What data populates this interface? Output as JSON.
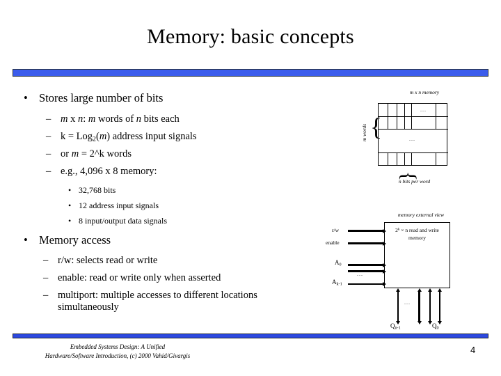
{
  "slide": {
    "title": "Memory: basic concepts",
    "page_number": "4",
    "accent_color": "#3b5cec",
    "footer_line1": "Embedded Systems Design: A Unified",
    "footer_line2": "Hardware/Software Introduction, (c) 2000 Vahid/Givargis"
  },
  "content": {
    "bullet1": "Stores large number of bits",
    "bullet1_subs": [
      {
        "pre": "",
        "italic1": "m",
        "mid": " x ",
        "italic2": "n",
        "post": ": ",
        "italic3": "m",
        "post2": " words of ",
        "italic4": "n",
        "post3": " bits each"
      }
    ],
    "sub_a_full": "m x n: m words of n bits each",
    "sub_b_full": "k = Log2(m) address input signals",
    "sub_b_p1": "k = Log",
    "sub_b_sub": "2",
    "sub_b_p2": "(",
    "sub_b_var": "m",
    "sub_b_p3": ") address input signals",
    "sub_c_p1": "or ",
    "sub_c_var": "m",
    "sub_c_p2": " = 2^k words",
    "sub_d": "e.g., 4,096 x 8 memory:",
    "lvl3_items": [
      "32,768 bits",
      "12 address input signals",
      "8 input/output data signals"
    ],
    "bullet2": "Memory access",
    "bullet2_subs": [
      "r/w: selects read or write",
      "enable: read or write only when asserted"
    ],
    "bullet2_sub3_line1": "multiport: multiple accesses to different locations",
    "bullet2_sub3_line2": "simultaneously"
  },
  "array_diagram": {
    "title": "m x n memory",
    "side_label": "m words",
    "bottom_label": "n bits per word",
    "cell_dots": "...",
    "row_dots": "..."
  },
  "external_diagram": {
    "title": "memory external view",
    "box_line1_p1": "2",
    "box_line1_sup": "k",
    "box_line1_p2": " × n read and write",
    "box_line2": "memory",
    "input_rw": "r/w",
    "input_enable": "enable",
    "addr_first": "A",
    "addr_first_sub": "0",
    "addr_dots": "...",
    "addr_last": "A",
    "addr_last_sub": "k-1",
    "out_dots": "...",
    "out_last": "Q",
    "out_last_sub": "n-1",
    "out_first": "Q",
    "out_first_sub": "0"
  }
}
